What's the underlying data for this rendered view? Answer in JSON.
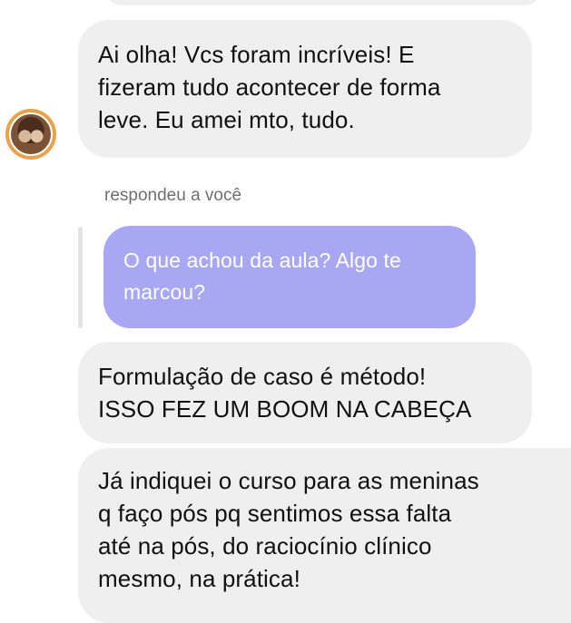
{
  "messages": [
    {
      "id": "msg1",
      "lines": [
        "Ai olha! Vcs foram incríveis! E",
        "fizeram tudo acontecer de forma",
        "leve. Eu amei mto, tudo."
      ]
    },
    {
      "id": "msg2",
      "lines": [
        "Formulação de caso é método!",
        "ISSO FEZ UM BOOM NA CABEÇA"
      ]
    },
    {
      "id": "msg3",
      "lines": [
        "Já indiquei o curso para as meninas",
        "q faço pós pq sentimos essa falta",
        "até na pós, do raciocínio clínico",
        "mesmo, na prática!"
      ]
    }
  ],
  "reply": {
    "label": "respondeu a você",
    "quoted_lines": [
      "O que achou da aula? Algo te",
      "marcou?"
    ]
  },
  "colors": {
    "incoming_bubble": "#efefef",
    "quoted_bubble": "#a7a7f3",
    "avatar_ring": "#e8a24a"
  },
  "icons": {
    "avatar": "profile-avatar"
  }
}
